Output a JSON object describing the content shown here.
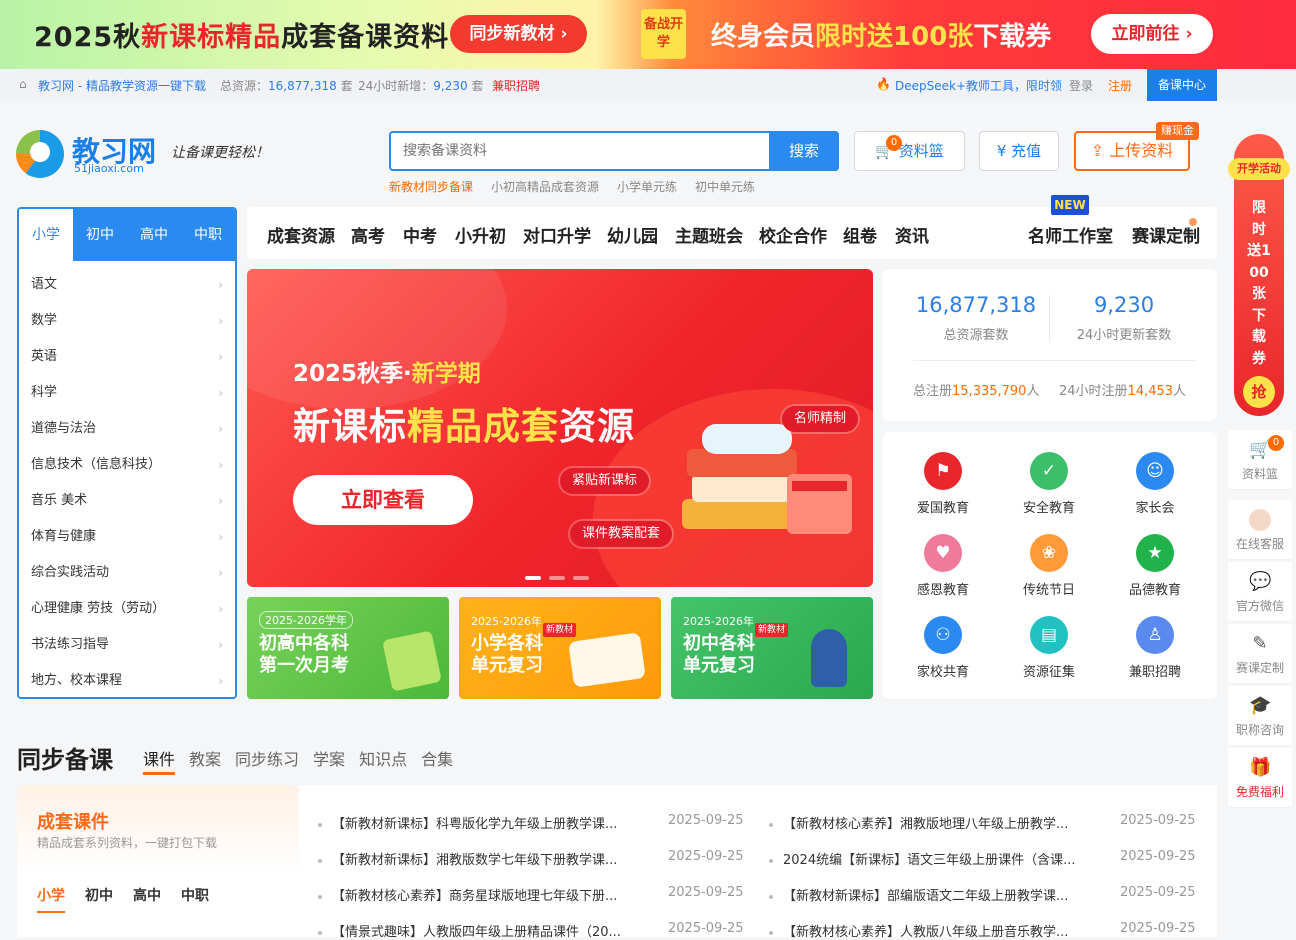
{
  "promo": {
    "left_prefix": "2025秋",
    "left_highlight": "新课标精品",
    "left_suffix": "成套备课资料",
    "btn1": "同步新教材",
    "tag": "备战开学",
    "right_prefix": "终身会员",
    "right_highlight": "限时送100张",
    "right_suffix": "下载券",
    "btn2": "立即前往"
  },
  "topbar": {
    "site": "教习网 - 精品教学资源一键下载",
    "total_label": "总资源：",
    "total_value": "16,877,318",
    "total_unit": "套",
    "new_label": "24小时新增：",
    "new_value": "9,230",
    "new_unit": "套",
    "recruit": "兼职招聘",
    "deepseek": "DeepSeek+教师工具，限时领",
    "login": "登录",
    "register": "注册",
    "center": "备课中心"
  },
  "header": {
    "logo_text": "教习网",
    "logo_sub": "51jiaoxi.com",
    "slogan": "让备课更轻松！",
    "search_placeholder": "搜索备课资料",
    "search_btn": "搜索",
    "hot": [
      "新教材同步备课",
      "小初高精品成套资源",
      "小学单元练",
      "初中单元练"
    ],
    "basket": "资料篮",
    "basket_count": "0",
    "recharge": "充值",
    "upload": "上传资料",
    "earn": "赚现金"
  },
  "leftmenu": {
    "tabs": [
      "小学",
      "初中",
      "高中",
      "中职"
    ],
    "items": [
      "语文",
      "数学",
      "英语",
      "科学",
      "道德与法治",
      "信息技术（信息科技）",
      "音乐  美术",
      "体育与健康",
      "综合实践活动",
      "心理健康  劳技（劳动）",
      "书法练习指导",
      "地方、校本课程"
    ]
  },
  "nav": {
    "items": [
      "成套资源",
      "高考",
      "中考",
      "小升初",
      "对口升学",
      "幼儿园",
      "主题班会",
      "校企合作",
      "组卷",
      "资讯"
    ],
    "studio": "名师工作室",
    "custom": "赛课定制",
    "new_tag": "NEW"
  },
  "hero": {
    "line1_a": "2025秋季·",
    "line1_b": "新学期",
    "line2_a": "新课标",
    "line2_b": "精品成套",
    "line2_c": "资源",
    "cta": "立即查看",
    "pill1": "名师精制",
    "pill2": "紧贴新课标",
    "pill3": "课件教案配套"
  },
  "stats": {
    "total_value": "16,877,318",
    "total_label": "总资源套数",
    "daily_value": "9,230",
    "daily_label": "24小时更新套数",
    "reg_label": "总注册",
    "reg_value": "15,335,790",
    "reg_unit": "人",
    "reg24_label": "24小时注册",
    "reg24_value": "14,453",
    "reg24_unit": "人"
  },
  "icons": [
    {
      "label": "爱国教育",
      "color": "#e8262b",
      "icon": "flag-icon"
    },
    {
      "label": "安全教育",
      "color": "#3cbf6a",
      "icon": "shield-icon"
    },
    {
      "label": "家长会",
      "color": "#2b8af0",
      "icon": "people-icon"
    },
    {
      "label": "感恩教育",
      "color": "#f07a9a",
      "icon": "heart-hand-icon"
    },
    {
      "label": "传统节日",
      "color": "#ff9a3a",
      "icon": "lantern-icon"
    },
    {
      "label": "品德教育",
      "color": "#22b24c",
      "icon": "star-hand-icon"
    },
    {
      "label": "家校共育",
      "color": "#2b8af0",
      "icon": "family-icon"
    },
    {
      "label": "资源征集",
      "color": "#22c0c0",
      "icon": "document-icon"
    },
    {
      "label": "兼职招聘",
      "color": "#5a8af0",
      "icon": "person-icon"
    }
  ],
  "subbanners": [
    {
      "year": "2025-2026学年",
      "title1": "初高中各科",
      "title2": "第一次月考",
      "tag": ""
    },
    {
      "year": "2025-2026年",
      "title1": "小学各科",
      "title2": "单元复习",
      "tag": "新教材"
    },
    {
      "year": "2025-2026年",
      "title1": "初中各科",
      "title2": "单元复习",
      "tag": "新教材"
    }
  ],
  "floating": {
    "activity_top": "开学活动",
    "activity_text": "限时送100张下载券",
    "grab": "抢",
    "items": [
      "资料篮",
      "在线客服",
      "官方微信",
      "赛课定制",
      "职称咨询",
      "免费福利"
    ],
    "basket_count": "0"
  },
  "section": {
    "title": "同步备课",
    "tabs": [
      "课件",
      "教案",
      "同步练习",
      "学案",
      "知识点",
      "合集"
    ],
    "kit_title": "成套课件",
    "kit_sub": "精品成套系列资料，一键打包下载",
    "kit_tabs": [
      "小学",
      "初中",
      "高中",
      "中职"
    ],
    "left_list": [
      {
        "title": "【新教材新课标】科粤版化学九年级上册教学课...",
        "date": "2025-09-25"
      },
      {
        "title": "【新教材新课标】湘教版数学七年级下册教学课...",
        "date": "2025-09-25"
      },
      {
        "title": "【新教材核心素养】商务星球版地理七年级下册...",
        "date": "2025-09-25"
      },
      {
        "title": "【情景式趣味】人教版四年级上册精品课件（20...",
        "date": "2025-09-25"
      }
    ],
    "right_list": [
      {
        "title": "【新教材核心素养】湘教版地理八年级上册教学...",
        "date": "2025-09-25"
      },
      {
        "title": "2024统编【新课标】语文三年级上册课件（含课...",
        "date": "2025-09-25"
      },
      {
        "title": "【新教材新课标】部编版语文二年级上册教学课...",
        "date": "2025-09-25"
      },
      {
        "title": "【新教材核心素养】人教版八年级上册音乐教学...",
        "date": "2025-09-25"
      }
    ]
  }
}
